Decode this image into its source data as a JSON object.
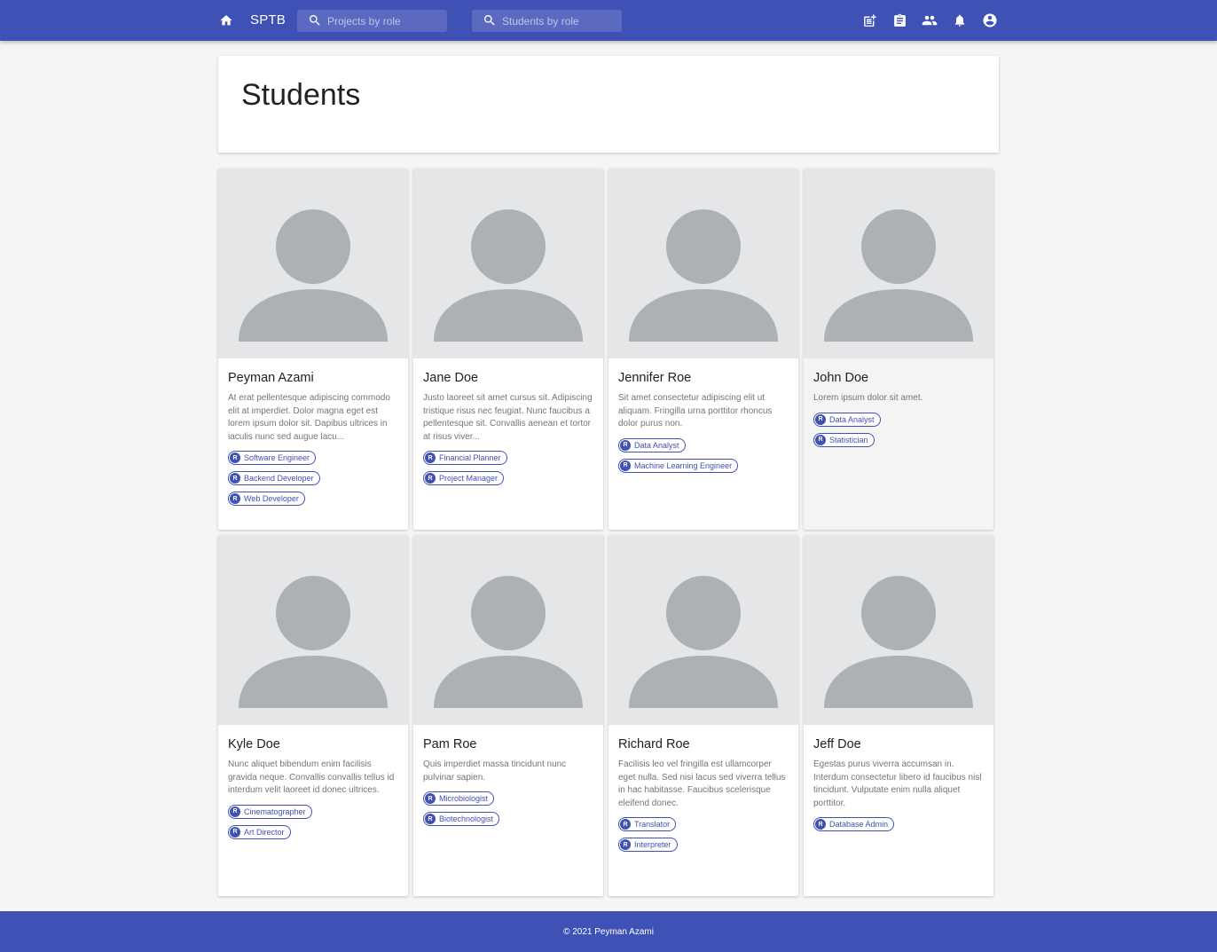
{
  "topbar": {
    "brand": "SPTB",
    "search_projects_placeholder": "Projects by role",
    "search_students_placeholder": "Students by role"
  },
  "page": {
    "title": "Students"
  },
  "students": [
    {
      "name": "Peyman Azami",
      "description": "At erat pellentesque adipiscing commodo elit at imperdiet. Dolor magna eget est lorem ipsum dolor sit. Dapibus ultrices in iaculis nunc sed augue lacu...",
      "roles": [
        "Software Engineer",
        "Backend Developer",
        "Web Developer"
      ]
    },
    {
      "name": "Jane Doe",
      "description": "Justo laoreet sit amet cursus sit. Adipiscing tristique risus nec feugiat. Nunc faucibus a pellentesque sit. Convallis aenean et tortor at risus viver...",
      "roles": [
        "Financial Planner",
        "Project Manager"
      ]
    },
    {
      "name": "Jennifer Roe",
      "description": "Sit amet consectetur adipiscing elit ut aliquam. Fringilla urna porttitor rhoncus dolor purus non.",
      "roles": [
        "Data Analyst",
        "Machine Learning Engineer"
      ]
    },
    {
      "name": "John Doe",
      "description": "Lorem ipsum dolor sit amet.",
      "roles": [
        "Data Analyst",
        "Statistician"
      ]
    },
    {
      "name": "Kyle Doe",
      "description": "Nunc aliquet bibendum enim facilisis gravida neque. Convallis convallis tellus id interdum velit laoreet id donec ultrices.",
      "roles": [
        "Cinematographer",
        "Art Director"
      ]
    },
    {
      "name": "Pam Roe",
      "description": "Quis imperdiet massa tincidunt nunc pulvinar sapien.",
      "roles": [
        "Microbiologist",
        "Biotechnologist"
      ]
    },
    {
      "name": "Richard Roe",
      "description": "Facilisis leo vel fringilla est ullamcorper eget nulla. Sed nisi lacus sed viverra tellus in hac habitasse. Faucibus scelerisque eleifend donec.",
      "roles": [
        "Translator",
        "Interpreter"
      ]
    },
    {
      "name": "Jeff Doe",
      "description": "Egestas purus viverra accumsan in. Interdum consectetur libero id faucibus nisl tincidunt. Vulputate enim nulla aliquet porttitor.",
      "roles": [
        "Database Admin"
      ]
    }
  ],
  "role_badge_letter": "R",
  "footer": {
    "text": "© 2021 Peyman Azami"
  },
  "colors": {
    "primary": "#3f51b5",
    "background": "#f5f5f5",
    "avatar_bg": "#e4e6e8",
    "avatar_fg": "#adb1b5"
  }
}
